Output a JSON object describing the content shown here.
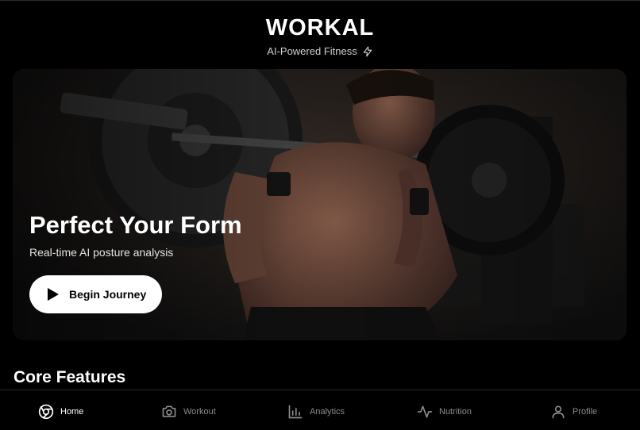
{
  "header": {
    "brand": "WORKAL",
    "tagline": "AI-Powered Fitness",
    "tagline_icon": "lightning-icon"
  },
  "hero": {
    "title": "Perfect Your Form",
    "subtitle": "Real-time AI posture analysis",
    "cta_label": "Begin Journey",
    "cta_icon": "play-icon",
    "image": "athlete-barbell-squat-photo"
  },
  "sections": {
    "core_features_title": "Core Features"
  },
  "tabbar": {
    "active": "Home",
    "items": [
      {
        "label": "Home",
        "icon": "compass-icon"
      },
      {
        "label": "Workout",
        "icon": "camera-icon"
      },
      {
        "label": "Analytics",
        "icon": "bar-chart-icon"
      },
      {
        "label": "Nutrition",
        "icon": "activity-icon"
      },
      {
        "label": "Profile",
        "icon": "user-icon"
      }
    ]
  },
  "colors": {
    "background": "#000000",
    "text": "#ffffff",
    "muted": "#8b8b8b",
    "button_bg": "#ffffff",
    "button_text": "#000000"
  }
}
